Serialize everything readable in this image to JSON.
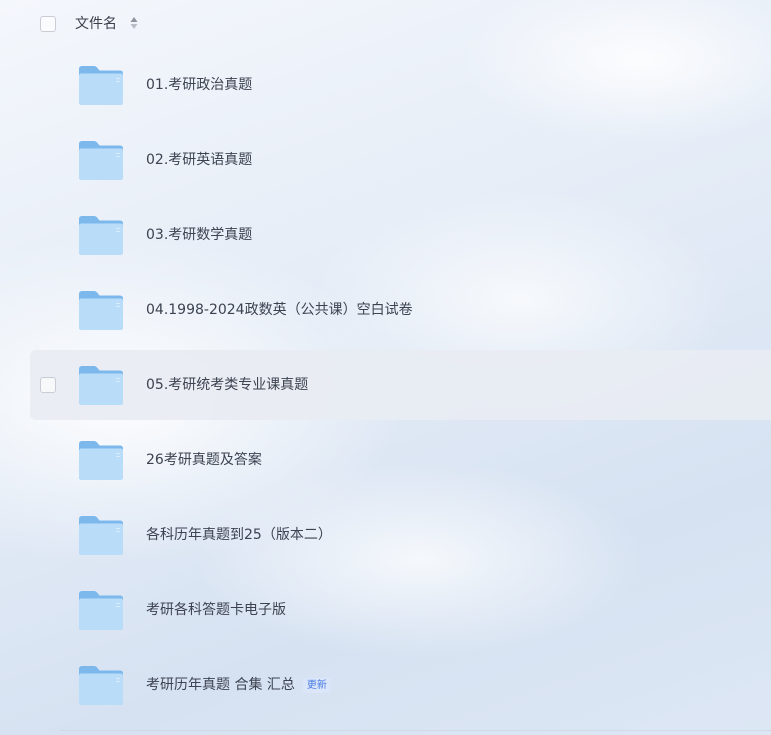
{
  "header": {
    "column_label": "文件名"
  },
  "files": [
    {
      "name": "01.考研政治真题",
      "type": "folder-icon"
    },
    {
      "name": "02.考研英语真题",
      "type": "folder-icon"
    },
    {
      "name": "03.考研数学真题",
      "type": "folder-icon"
    },
    {
      "name": "04.1998-2024政数英（公共课）空白试卷",
      "type": "folder-icon"
    },
    {
      "name": "05.考研统考类专业课真题",
      "type": "folder-icon"
    },
    {
      "name": "26考研真题及答案",
      "type": "folder-icon"
    },
    {
      "name": "各科历年真题到25（版本二）",
      "type": "folder-icon"
    },
    {
      "name": "考研各科答题卡电子版",
      "type": "folder-icon"
    },
    {
      "name": "考研历年真题  合集 汇总",
      "type": "folder-icon",
      "badge": "更新"
    }
  ],
  "colors": {
    "folder_light": "#b9dcf8",
    "folder_dark": "#7db8ec",
    "badge_text": "#4a7ce0",
    "badge_bg": "#dbe6fb"
  }
}
